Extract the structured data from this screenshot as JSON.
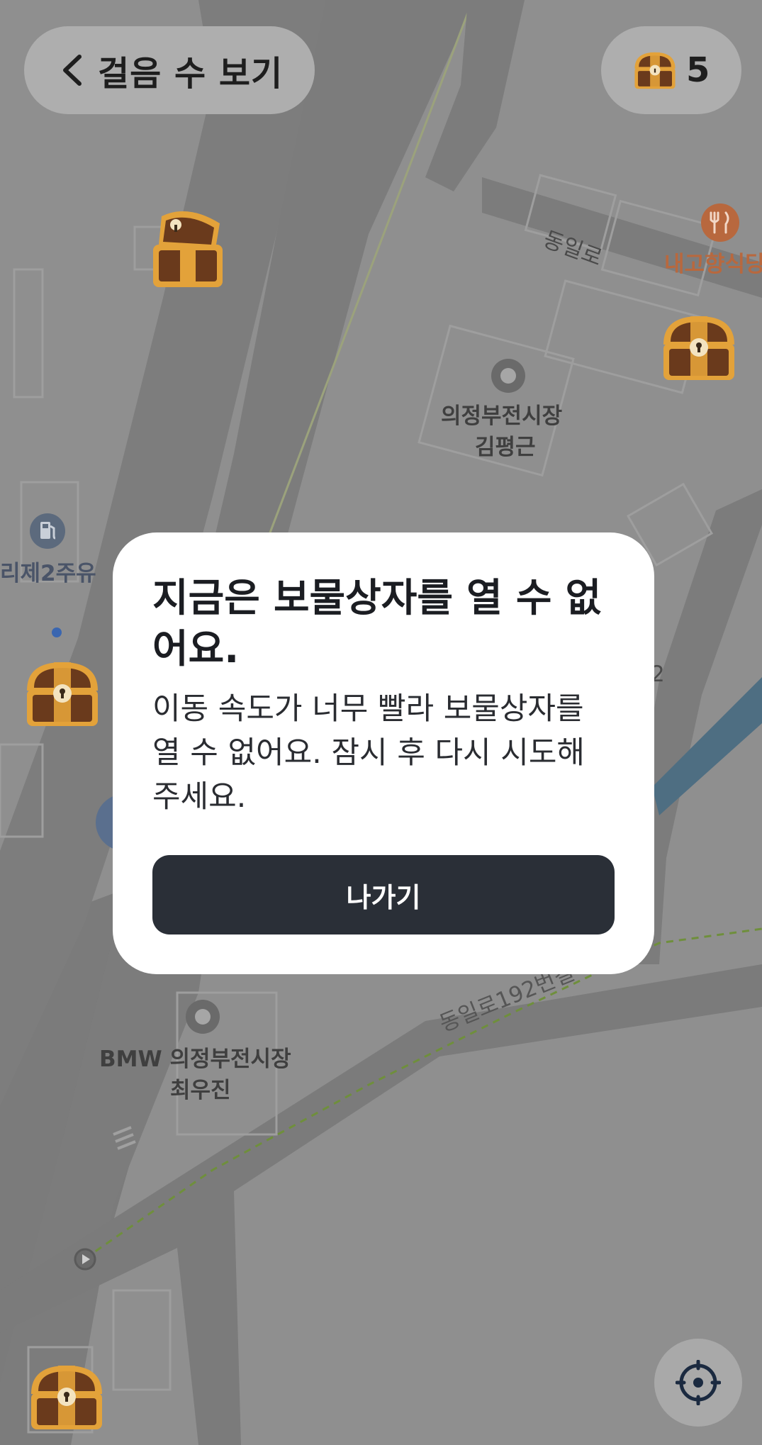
{
  "header": {
    "back_label": "걸음 수 보기",
    "chest_count": "5"
  },
  "map": {
    "labels": {
      "dongil_ro": "동일로",
      "restaurant": "내고향식당",
      "poi_1_line1": "의정부전시장",
      "poi_1_line2": "김평근",
      "gas_station": "리제2주유",
      "partial_road": "2",
      "poi_2_line1": "BMW 의정부전시장",
      "poi_2_line2": "최우진",
      "dongil_ro_192": "동일로192번길"
    }
  },
  "dialog": {
    "title": "지금은 보물상자를 열 수 없어요.",
    "body": "이동 속도가 너무 빨라 보물상자를 열 수 없어요. 잠시 후 다시 시도해 주세요.",
    "button_label": "나가기"
  },
  "icons": {
    "back": "chevron-left-icon",
    "chest": "treasure-chest-icon",
    "locate": "crosshair-icon",
    "restaurant": "fork-knife-icon",
    "gas": "fuel-pump-icon",
    "poi": "ring-marker-icon"
  },
  "colors": {
    "overlay_map_bg": "#8f8f8f",
    "road": "#7a7a7a",
    "dialog_bg": "#ffffff",
    "button_bg": "#2a2f37",
    "water": "#4e6e82",
    "chest_wood": "#6a3a1c",
    "chest_gold": "#e3a23a",
    "food_label": "#b8683e"
  }
}
